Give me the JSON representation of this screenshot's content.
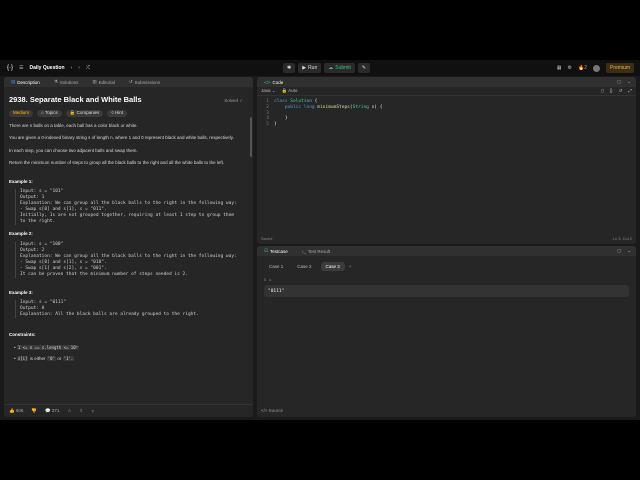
{
  "topbar": {
    "logo": "{·}",
    "problem_list": "Daily Question",
    "run": "Run",
    "submit": "Submit",
    "streak": "2",
    "premium": "Premium"
  },
  "left": {
    "tabs": [
      "Description",
      "Solutions",
      "Editorial",
      "Submissions"
    ],
    "title": "2938. Separate Black and White Balls",
    "solved": "Solved",
    "tags": [
      "Medium",
      "Topics",
      "Companies",
      "Hint"
    ],
    "p1": "There are n balls on a table, each ball has a color black or white.",
    "p2": "You are given a 0-indexed binary string s of length n, where 1 and 0 represent black and white balls, respectively.",
    "p3": "In each step, you can choose two adjacent balls and swap them.",
    "p4": "Return the minimum number of steps to group all the black balls to the right and all the white balls to the left.",
    "ex1_title": "Example 1:",
    "ex1_body": "Input: s = \"101\"\nOutput: 1\nExplanation: We can group all the black balls to the right in the following way:\n- Swap s[0] and s[1], s = \"011\".\nInitially, 1s are not grouped together, requiring at least 1 step to group them\nto the right.",
    "ex2_title": "Example 2:",
    "ex2_body": "Input: s = \"100\"\nOutput: 2\nExplanation: We can group all the black balls to the right in the following way:\n- Swap s[0] and s[1], s = \"010\".\n- Swap s[1] and s[2], s = \"001\".\nIt can be proven that the minimum number of steps needed is 2.",
    "ex3_title": "Example 3:",
    "ex3_body": "Input: s = \"0111\"\nOutput: 0\nExplanation: All the black balls are already grouped to the right.",
    "constraints_title": "Constraints:",
    "c1": "1 <= n == s.length <= 10⁵",
    "c2a": "s[i]",
    "c2b": "is either",
    "c2c": "'0'",
    "c2d": "or",
    "c2e": "'1'.",
    "likes": "606",
    "comments": "371"
  },
  "code": {
    "tab": "Code",
    "lang": "Java",
    "auto": "Auto",
    "lines": [
      "class Solution {",
      "    public long minimumSteps(String s) {",
      "        ",
      "    }",
      "}"
    ],
    "saved": "Saved",
    "position": "Ln 3, Col 2"
  },
  "test": {
    "tabs": [
      "Testcase",
      "Test Result"
    ],
    "cases": [
      "Case 1",
      "Case 2",
      "Case 3"
    ],
    "var": "s =",
    "value": "\"0111\"",
    "source": "Source"
  }
}
